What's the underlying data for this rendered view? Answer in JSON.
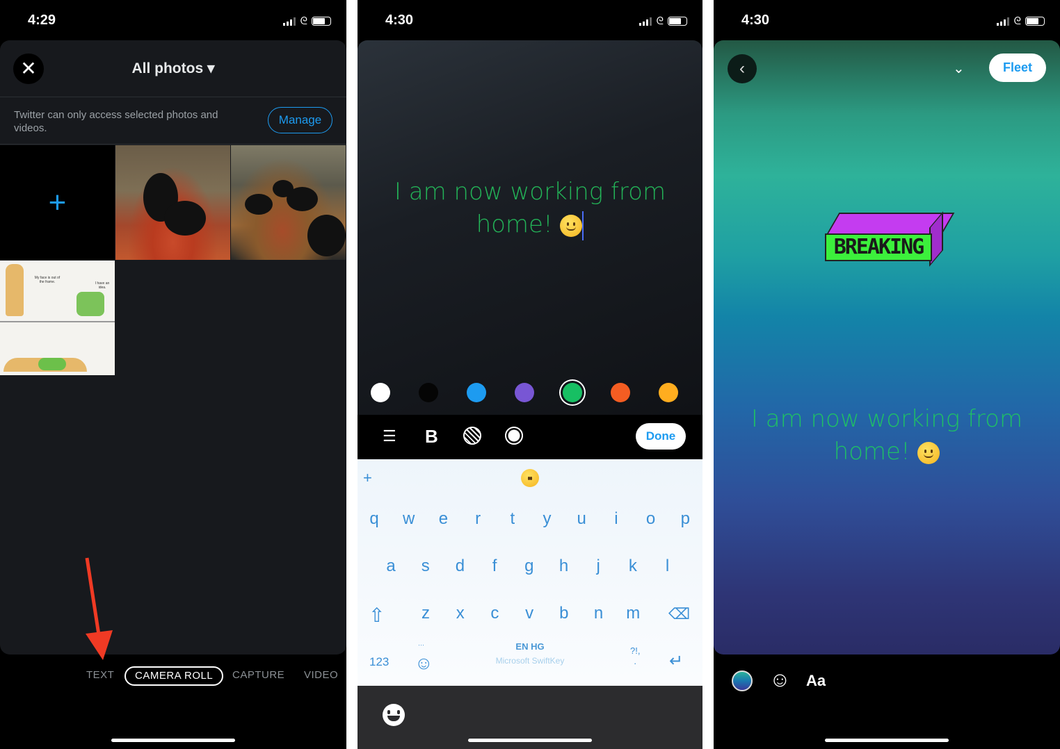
{
  "panel1": {
    "status": {
      "time": "4:29"
    },
    "header": {
      "title": "All photos ▾",
      "close_icon": "close-icon"
    },
    "notice": {
      "text": "Twitter can only access selected photos and videos.",
      "button": "Manage"
    },
    "grid": {
      "add_icon": "plus-icon",
      "comic_texts": [
        "My face is out of the frame.",
        "I have an idea."
      ]
    },
    "tabs": [
      "TEXT",
      "CAMERA ROLL",
      "CAPTURE",
      "VIDEO"
    ],
    "active_tab": "CAMERA ROLL",
    "annotation_color": "#f03a24"
  },
  "panel2": {
    "status": {
      "time": "4:30"
    },
    "fleet_text": {
      "line1": "I am now working from",
      "line2": "home!",
      "color": "#23b257"
    },
    "colors": [
      "#ffffff",
      "#000000",
      "#1d9bf0",
      "#7856d4",
      "#17bf63",
      "#f45d22",
      "#ffad1f"
    ],
    "selected_color": "#17bf63",
    "toolbar": {
      "align_icon": "align-center-icon",
      "bold": "B",
      "background_icon": "striped-circle-icon",
      "outline_icon": "ring-icon",
      "done": "Done"
    },
    "keyboard": {
      "row1": [
        "q",
        "w",
        "e",
        "r",
        "t",
        "y",
        "u",
        "i",
        "o",
        "p"
      ],
      "row2": [
        "a",
        "s",
        "d",
        "f",
        "g",
        "h",
        "j",
        "k",
        "l"
      ],
      "row3": [
        "z",
        "x",
        "c",
        "v",
        "b",
        "n",
        "m"
      ],
      "numbers": "123",
      "language": "EN HG",
      "brand": "Microsoft SwiftKey",
      "punct": "?!,",
      "punct_dot": ".",
      "suggestion_plus": "+",
      "ellipsis": "···"
    }
  },
  "panel3": {
    "status": {
      "time": "4:30"
    },
    "post_button": "Fleet",
    "sticker_text": "BREAKING",
    "fleet_text": {
      "line1": "I am now working from",
      "line2": "home!",
      "color": "#1fbf66"
    },
    "bottom": {
      "text_tool": "Aa",
      "color_icon": "gradient-color-icon",
      "sticker_icon": "sticker-icon"
    }
  }
}
